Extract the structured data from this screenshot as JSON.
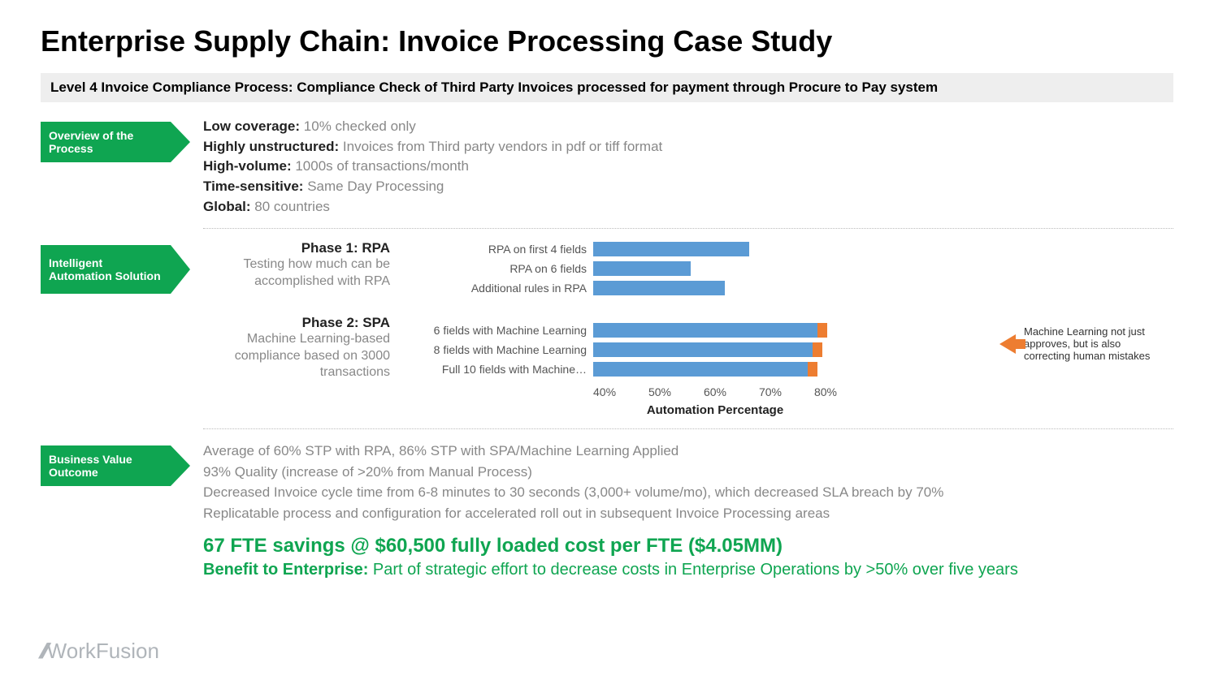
{
  "title": "Enterprise Supply Chain: Invoice Processing Case Study",
  "subtitle": "Level 4 Invoice Compliance Process: Compliance Check of Third Party Invoices processed for payment through Procure to Pay system",
  "section1": {
    "tag": "Overview of the Process",
    "items": [
      {
        "k": "Low coverage:",
        "v": "10% checked only"
      },
      {
        "k": "Highly unstructured:",
        "v": "Invoices from Third party vendors in pdf or tiff format"
      },
      {
        "k": "High-volume:",
        "v": "1000s of transactions/month"
      },
      {
        "k": "Time-sensitive:",
        "v": "Same Day Processing"
      },
      {
        "k": "Global:",
        "v": "80 countries"
      }
    ]
  },
  "section2": {
    "tag": "Intelligent Automation Solution",
    "phase1": {
      "title": "Phase 1: RPA",
      "desc": "Testing how much can be accomplished with RPA"
    },
    "phase2": {
      "title": "Phase 2: SPA",
      "desc": "Machine Learning-based compliance based on 3000 transactions"
    },
    "annotation": "Machine Learning not just approves, but is also correcting human mistakes",
    "chart_axis_title": "Automation Percentage"
  },
  "section3": {
    "tag": "Business Value Outcome",
    "lines": [
      "Average of 60% STP with RPA, 86% STP with SPA/Machine Learning Applied",
      "93% Quality (increase of >20% from Manual Process)",
      "Decreased Invoice cycle time from 6-8 minutes to 30 seconds (3,000+ volume/mo), which decreased SLA breach by 70%",
      "Replicatable process and configuration for accelerated roll out in subsequent Invoice Processing areas"
    ],
    "savings": "67 FTE savings @ $60,500 fully loaded cost per FTE ($4.05MM)",
    "benefit_label": "Benefit to Enterprise:",
    "benefit_text": "Part of strategic effort to decrease costs in Enterprise Operations by >50% over five years"
  },
  "logo": "WorkFusion",
  "chart_data": {
    "type": "bar",
    "orientation": "horizontal",
    "xlabel": "Automation Percentage",
    "xlim": [
      35,
      85
    ],
    "ticks": [
      "40%",
      "50%",
      "60%",
      "70%",
      "80%"
    ],
    "groups": [
      {
        "name": "Phase 1: RPA",
        "bars": [
          {
            "label": "RPA on first 4 fields",
            "blue": 67,
            "orange": 0
          },
          {
            "label": "RPA on 6 fields",
            "blue": 55,
            "orange": 0
          },
          {
            "label": "Additional rules in RPA",
            "blue": 62,
            "orange": 0
          }
        ]
      },
      {
        "name": "Phase 2: SPA",
        "bars": [
          {
            "label": "6 fields with Machine Learning",
            "blue": 81,
            "orange": 2
          },
          {
            "label": "8 fields with Machine Learning",
            "blue": 80,
            "orange": 2
          },
          {
            "label": "Full 10 fields with Machine…",
            "blue": 79,
            "orange": 2
          }
        ]
      }
    ],
    "annotation": "Machine Learning not just approves, but is also correcting human mistakes"
  }
}
